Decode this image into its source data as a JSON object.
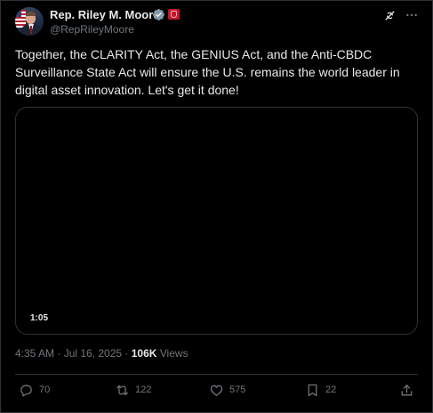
{
  "author": {
    "name": "Rep. Riley M. Moore",
    "handle": "@RepRileyMoore"
  },
  "tweet": {
    "text": "Together, the CLARITY Act, the GENIUS Act, and the Anti-CBDC\nSurveillance State Act will ensure the U.S. remains the world leader in\ndigital asset innovation. Let's get it done!"
  },
  "video": {
    "duration": "1:05"
  },
  "meta": {
    "timestamp": "4:35 AM · Jul 16, 2025 · ",
    "views_count": "106K",
    "views_label": " Views"
  },
  "actions": {
    "replies": "70",
    "reposts": "122",
    "likes": "575",
    "bookmarks": "22"
  },
  "icons": {
    "verified": "verified-badge-icon",
    "government": "government-badge-icon",
    "grok": "grok-icon",
    "more": "more-icon",
    "reply": "reply-icon",
    "repost": "repost-icon",
    "like": "like-icon",
    "bookmark": "bookmark-icon",
    "share": "share-icon"
  },
  "colors": {
    "background": "#000000",
    "text": "#e7e9ea",
    "secondary_text": "#71767b",
    "border": "#2f3336",
    "verified_badge": "#829aab",
    "government_badge": "#c4172c"
  }
}
